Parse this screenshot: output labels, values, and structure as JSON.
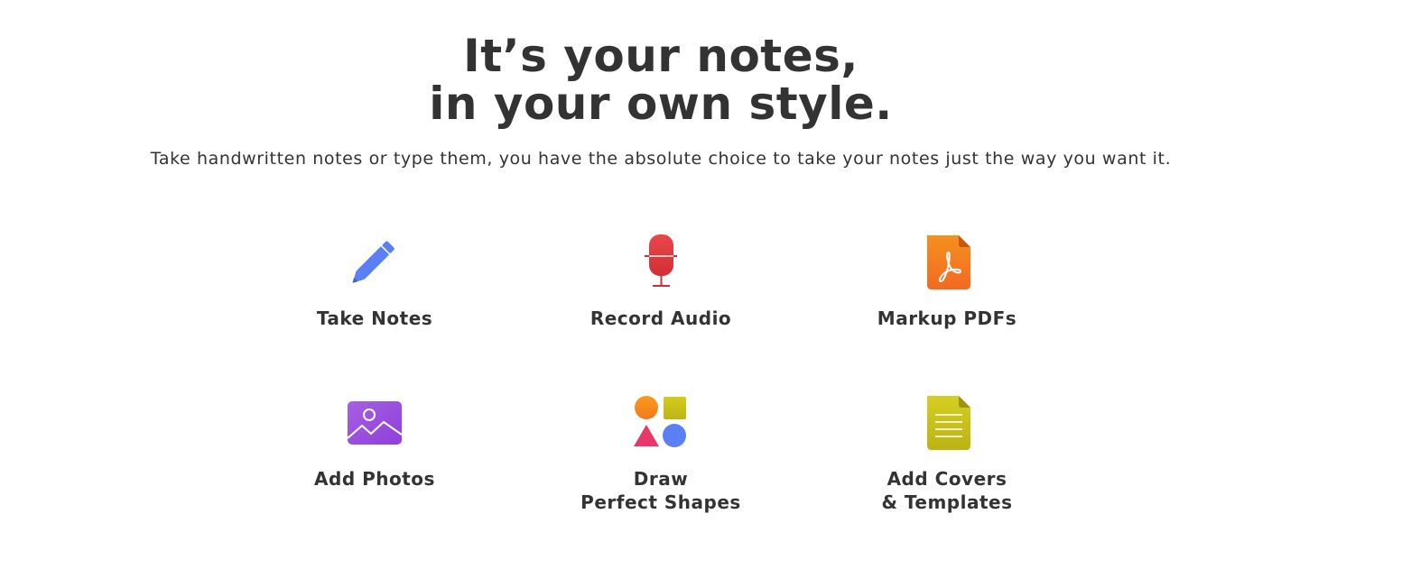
{
  "hero": {
    "title_line1": "It’s your notes,",
    "title_line2": "in your own style.",
    "subtitle": "Take handwritten notes or type them, you have the absolute choice to take your notes just the way you want it."
  },
  "features": [
    {
      "label": "Take Notes",
      "icon": "pencil-icon",
      "color": "#5B7FF5"
    },
    {
      "label": "Record Audio",
      "icon": "microphone-icon",
      "color": "#E03A3E"
    },
    {
      "label": "Markup PDFs",
      "icon": "pdf-file-icon",
      "color": "#F47C20"
    },
    {
      "label": "Add Photos",
      "icon": "photo-icon",
      "color": "#9B4FE0"
    },
    {
      "label": "Draw\nPerfect Shapes",
      "icon": "shapes-icon",
      "color": "#F08A1C"
    },
    {
      "label": "Add Covers\n& Templates",
      "icon": "template-document-icon",
      "color": "#C9C21A"
    }
  ]
}
